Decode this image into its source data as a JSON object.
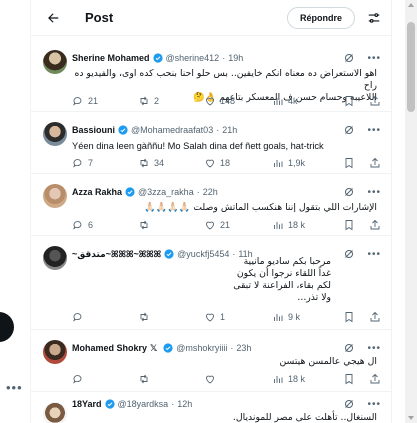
{
  "header": {
    "title": "Post",
    "reply_label": "Répondre"
  },
  "tweets": [
    {
      "name": "Sherine Mohamed",
      "handle": "@sherine412",
      "time": "19h",
      "x_badge": "",
      "lines": [
        "اهو الاستعراض ده معناه انكم خايفين.. بس حلو احنا بنحب كده اوى، والفيديو ده راح",
        "اللاعيبه وحسام حسن ف المعسكر بتاعهم 👌🤔"
      ],
      "dir": "rtl",
      "replies": "21",
      "reposts": "2",
      "likes": "148",
      "views": "4k"
    },
    {
      "name": "Bassiouni",
      "handle": "@Mohamedraafat03",
      "time": "21h",
      "x_badge": "",
      "lines": [
        "Yéen dina leen gàññu! Mo Salah dina def ñett goals, hat-trick"
      ],
      "dir": "ltr",
      "replies": "7",
      "reposts": "34",
      "likes": "18",
      "views": "1,9k"
    },
    {
      "name": "Azza Rakha",
      "handle": "@3zza_rakha",
      "time": "22h",
      "x_badge": "",
      "lines": [
        "الإشارات اللي بتقول إننا هنكسب الماتش وصلت 🙏🏻🙏🏻🙏🏻🙏🏻"
      ],
      "dir": "rtl",
      "replies": "6",
      "reposts": "",
      "likes": "21",
      "views": "18 k"
    },
    {
      "name": "~متدقق~ꕤꕤꕤ~ꕤꕤꕤ",
      "handle": "@yuckfj5454",
      "time": "11h",
      "x_badge": "",
      "lines": [
        "مرحبا بكم ساديو مانيية",
        "غداً اللقاء نرجوا أن يكون",
        "لكم بقاء، الفراعنة لا تبقى",
        "ولا تذر..."
      ],
      "dir": "rtl",
      "replies": "",
      "reposts": "",
      "likes": "1",
      "views": "9 k"
    },
    {
      "name": "Mohamed Shokry",
      "handle": "@mshokryiiii",
      "time": "23h",
      "x_badge": "𝕏",
      "lines": [
        "ال هيجي عالمسن هيتسن"
      ],
      "dir": "rtl",
      "replies": "",
      "reposts": "",
      "likes": "",
      "views": "18 k"
    },
    {
      "name": "18Yard",
      "handle": "@18yardksa",
      "time": "12h",
      "x_badge": "",
      "lines": [
        "السنغال.. تأهلت على مصر للمونديال."
      ],
      "dir": "rtl",
      "replies": "",
      "reposts": "",
      "likes": "",
      "views": ""
    }
  ],
  "colors": {
    "accent": "#1d9bf0",
    "muted": "#536471",
    "text": "#0f1419",
    "border": "#eff3f4"
  }
}
